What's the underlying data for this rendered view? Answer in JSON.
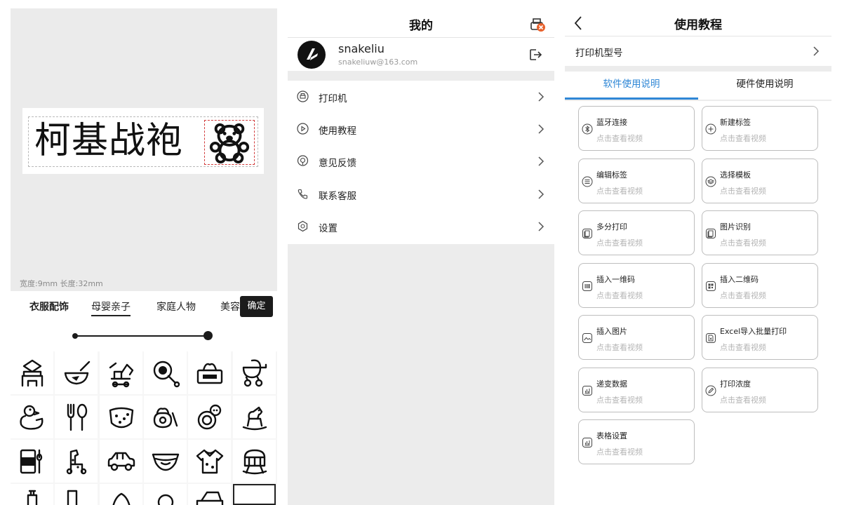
{
  "editor": {
    "label_text": "柯基战袍",
    "size_text": "宽度:9mm 长度:32mm",
    "categories": [
      "衣服配饰",
      "母婴亲子",
      "家庭人物",
      "美容"
    ],
    "confirm_label": "确定",
    "slider_value_fraction": 1.0,
    "grid_icons": [
      "toy-castle-icon",
      "baby-bowl-icon",
      "toy-excavator-icon",
      "rattle-icon",
      "tissue-box-icon",
      "stroller-icon",
      "rubber-duck-icon",
      "fork-spoon-icon",
      "diaper-pants-icon",
      "baby-cream-icon",
      "teether-ring-icon",
      "rocking-horse-icon",
      "formula-can-icon",
      "toy-giraffe-icon",
      "toy-car-icon",
      "diaper-icon",
      "baby-shirt-icon",
      "cradle-icon",
      "bottle-icon",
      "socks-icon",
      "hat-icon",
      "pacifier-icon",
      "bib-icon",
      "teddy-frame-icon"
    ]
  },
  "profile_page": {
    "title": "我的",
    "user_name": "snakeliu",
    "user_email": "snakeliuw@163.com",
    "menu": [
      {
        "label": "打印机",
        "icon": "printer-icon"
      },
      {
        "label": "使用教程",
        "icon": "play-circle-icon"
      },
      {
        "label": "意见反馈",
        "icon": "feedback-icon"
      },
      {
        "label": "联系客服",
        "icon": "phone-icon"
      },
      {
        "label": "设置",
        "icon": "settings-gear-icon"
      }
    ]
  },
  "tutorial_page": {
    "title": "使用教程",
    "model_row": "打印机型号",
    "tabs": [
      "软件使用说明",
      "硬件使用说明"
    ],
    "accent_color": "#2f87d6",
    "cards": [
      {
        "title": "蓝牙连接",
        "sub": "点击查看视频",
        "icon": "bluetooth-icon"
      },
      {
        "title": "新建标签",
        "sub": "点击查看视频",
        "icon": "plus-square-icon"
      },
      {
        "title": "编辑标签",
        "sub": "点击查看视频",
        "icon": "list-icon"
      },
      {
        "title": "选择模板",
        "sub": "点击查看视频",
        "icon": "layers-icon"
      },
      {
        "title": "多分打印",
        "sub": "点击查看视频",
        "icon": "copies-icon"
      },
      {
        "title": "图片识别",
        "sub": "点击查看视频",
        "icon": "scan-copy-icon"
      },
      {
        "title": "插入一维码",
        "sub": "点击查看视频",
        "icon": "barcode-icon"
      },
      {
        "title": "插入二维码",
        "sub": "点击查看视频",
        "icon": "qrcode-icon"
      },
      {
        "title": "插入图片",
        "sub": "点击查看视频",
        "icon": "image-icon"
      },
      {
        "title": "Excel导入批量打印",
        "sub": "点击查看视频",
        "icon": "excel-file-icon"
      },
      {
        "title": "递变数据",
        "sub": "点击查看视频",
        "icon": "chart-icon"
      },
      {
        "title": "打印浓度",
        "sub": "点击查看视频",
        "icon": "density-pen-icon"
      },
      {
        "title": "表格设置",
        "sub": "点击查看视频",
        "icon": "table-chart-icon"
      }
    ]
  }
}
